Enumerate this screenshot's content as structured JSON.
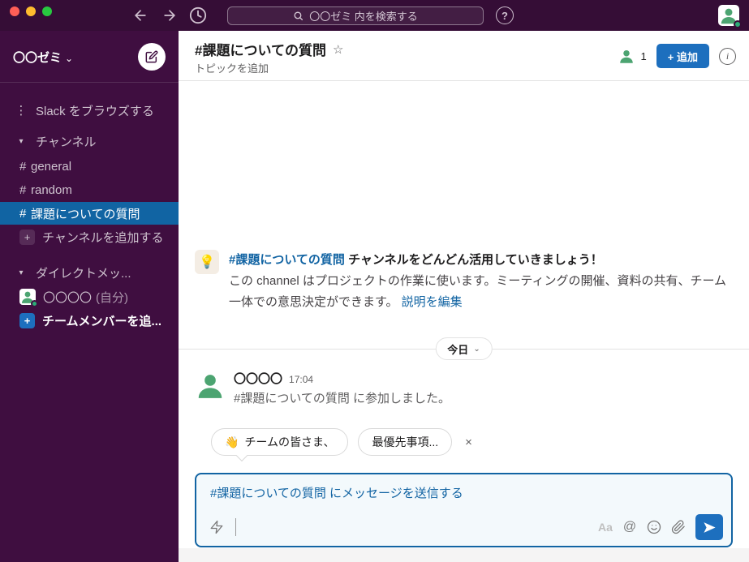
{
  "colors": {
    "topbar": "#350d36",
    "sidebar": "#3f0e40",
    "selected_channel": "#1164a3",
    "accent_blue": "#1264a3",
    "button_blue": "#1d6fbe",
    "avatar_green": "#4ca471",
    "status_green": "#2bac76"
  },
  "titlebar": {
    "search_placeholder": "〇〇ゼミ 内を検索する"
  },
  "sidebar": {
    "workspace_name": "〇〇ゼミ",
    "browse_label": "Slack をブラウズする",
    "sections": {
      "channels": "チャンネル",
      "dms": "ダイレクトメッ..."
    },
    "channels": [
      {
        "name": "general"
      },
      {
        "name": "random"
      },
      {
        "name": "課題についての質問"
      }
    ],
    "add_channel_label": "チャンネルを追加する",
    "dm_user_name": "〇〇〇〇",
    "dm_user_suffix": "(自分)",
    "add_member_label": "チームメンバーを追..."
  },
  "channel_header": {
    "name": "#課題についての質問",
    "topic": "トピックを追加",
    "member_count": "1",
    "add_button_label": "+ 追加"
  },
  "intro": {
    "channel_link": "#課題についての質問",
    "title_rest": " チャンネルをどんどん活用していきましょう！",
    "body": "この channel はプロジェクトの作業に使います。ミーティングの開催、資料の共有、チーム一体での意思決定ができます。 ",
    "edit_link": "説明を編集",
    "bulb_emoji": "💡"
  },
  "date_divider": {
    "label": "今日"
  },
  "message": {
    "author": "〇〇〇〇",
    "time": "17:04",
    "text": "#課題についての質問 に参加しました。"
  },
  "suggestions": {
    "chip1_emoji": "👋",
    "chip1_label": "チームの皆さま、",
    "chip2_label": "最優先事項...",
    "close": "×"
  },
  "composer": {
    "placeholder": "#課題についての質問 にメッセージを送信する",
    "format_label": "Aa",
    "at_label": "@"
  },
  "icons": {
    "browse": "⋮",
    "section_caret": "▾",
    "workspace_chevron": "⌄",
    "hash": "#",
    "plus": "+",
    "star": "☆",
    "help": "?",
    "info": "i",
    "pill_chevron": "⌄"
  }
}
